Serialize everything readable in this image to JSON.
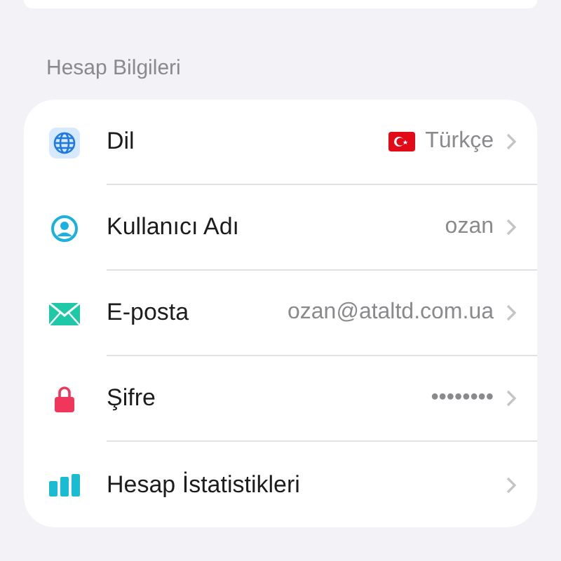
{
  "section": {
    "title": "Hesap Bilgileri"
  },
  "rows": [
    {
      "label": "Dil",
      "value": "Türkçe",
      "flag": true
    },
    {
      "label": "Kullanıcı Adı",
      "value": "ozan",
      "flag": false
    },
    {
      "label": "E-posta",
      "value": "ozan@ataltd.com.ua",
      "flag": false
    },
    {
      "label": "Şifre",
      "value": "••••••••",
      "flag": false
    },
    {
      "label": "Hesap İstatistikleri",
      "flag": false
    }
  ]
}
